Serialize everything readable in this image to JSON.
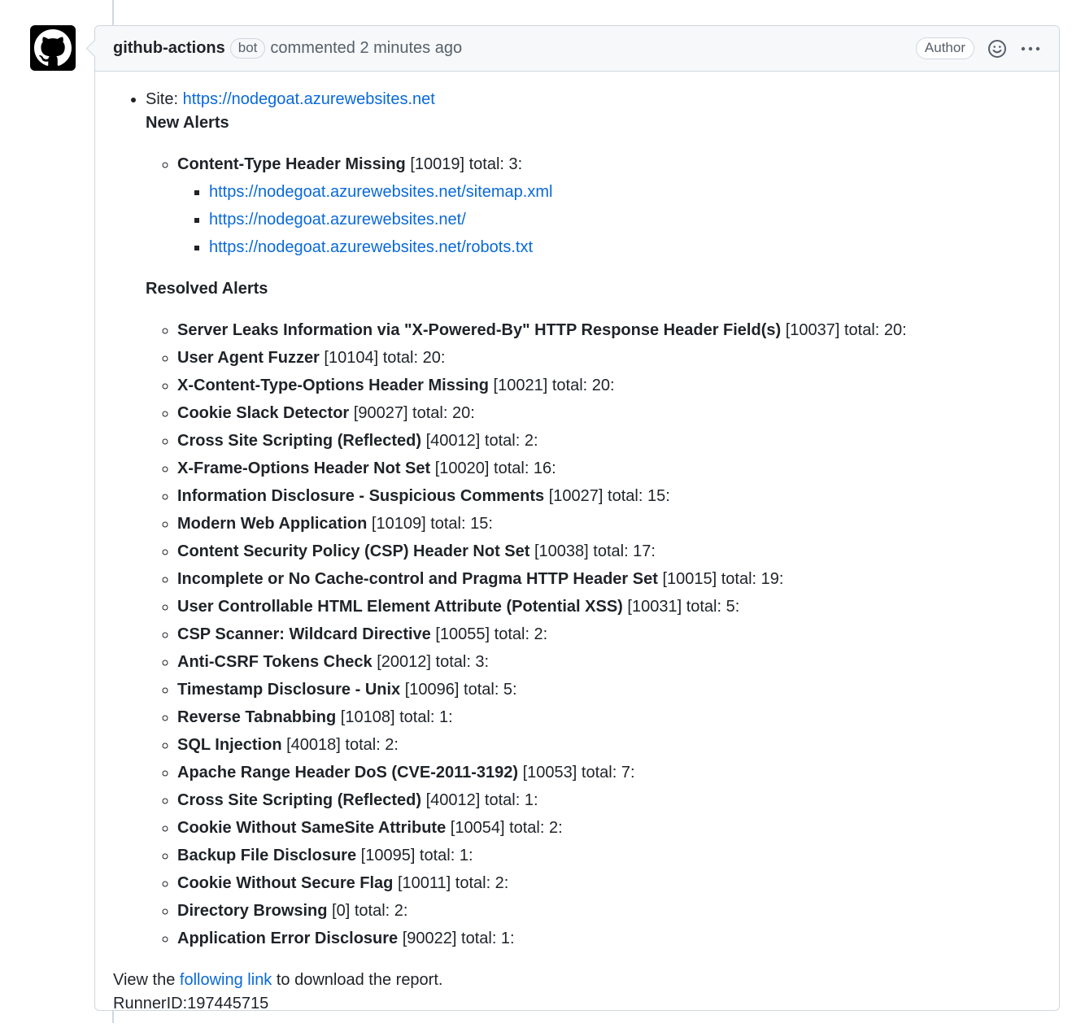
{
  "comment": {
    "author": "github-actions",
    "bot_label": "bot",
    "time_text": "commented 2 minutes ago",
    "author_badge": "Author"
  },
  "report": {
    "site_label": "Site:",
    "site_url": "https://nodegoat.azurewebsites.net",
    "new_alerts_heading": "New Alerts",
    "new_alert": {
      "name": "Content-Type Header Missing",
      "info": "[10019] total: 3:",
      "urls": [
        "https://nodegoat.azurewebsites.net/sitemap.xml",
        "https://nodegoat.azurewebsites.net/",
        "https://nodegoat.azurewebsites.net/robots.txt"
      ]
    },
    "resolved_heading": "Resolved Alerts",
    "resolved": [
      {
        "name": "Server Leaks Information via \"X-Powered-By\" HTTP Response Header Field(s)",
        "info": "[10037] total: 20:"
      },
      {
        "name": "User Agent Fuzzer",
        "info": "[10104] total: 20:"
      },
      {
        "name": "X-Content-Type-Options Header Missing",
        "info": "[10021] total: 20:"
      },
      {
        "name": "Cookie Slack Detector",
        "info": "[90027] total: 20:"
      },
      {
        "name": "Cross Site Scripting (Reflected)",
        "info": "[40012] total: 2:"
      },
      {
        "name": "X-Frame-Options Header Not Set",
        "info": "[10020] total: 16:"
      },
      {
        "name": "Information Disclosure - Suspicious Comments",
        "info": "[10027] total: 15:"
      },
      {
        "name": "Modern Web Application",
        "info": "[10109] total: 15:"
      },
      {
        "name": "Content Security Policy (CSP) Header Not Set",
        "info": "[10038] total: 17:"
      },
      {
        "name": "Incomplete or No Cache-control and Pragma HTTP Header Set",
        "info": "[10015] total: 19:"
      },
      {
        "name": "User Controllable HTML Element Attribute (Potential XSS)",
        "info": "[10031] total: 5:"
      },
      {
        "name": "CSP Scanner: Wildcard Directive",
        "info": "[10055] total: 2:"
      },
      {
        "name": "Anti-CSRF Tokens Check",
        "info": "[20012] total: 3:"
      },
      {
        "name": "Timestamp Disclosure - Unix",
        "info": "[10096] total: 5:"
      },
      {
        "name": "Reverse Tabnabbing",
        "info": "[10108] total: 1:"
      },
      {
        "name": "SQL Injection",
        "info": "[40018] total: 2:"
      },
      {
        "name": "Apache Range Header DoS (CVE-2011-3192)",
        "info": "[10053] total: 7:"
      },
      {
        "name": "Cross Site Scripting (Reflected)",
        "info": "[40012] total: 1:"
      },
      {
        "name": "Cookie Without SameSite Attribute",
        "info": "[10054] total: 2:"
      },
      {
        "name": "Backup File Disclosure",
        "info": "[10095] total: 1:"
      },
      {
        "name": "Cookie Without Secure Flag",
        "info": "[10011] total: 2:"
      },
      {
        "name": "Directory Browsing",
        "info": "[0] total: 2:"
      },
      {
        "name": "Application Error Disclosure",
        "info": "[90022] total: 1:"
      }
    ],
    "footer_pre": "View the",
    "footer_link": "following link",
    "footer_post": "to download the report.",
    "runner_id": "RunnerID:197445715"
  },
  "icons": {
    "avatar": "github-logo-icon",
    "reaction": "smiley-icon",
    "menu": "kebab-icon"
  },
  "colors": {
    "link": "#0969da",
    "header_bg": "#f6f8fa",
    "border": "#d0d7de"
  }
}
